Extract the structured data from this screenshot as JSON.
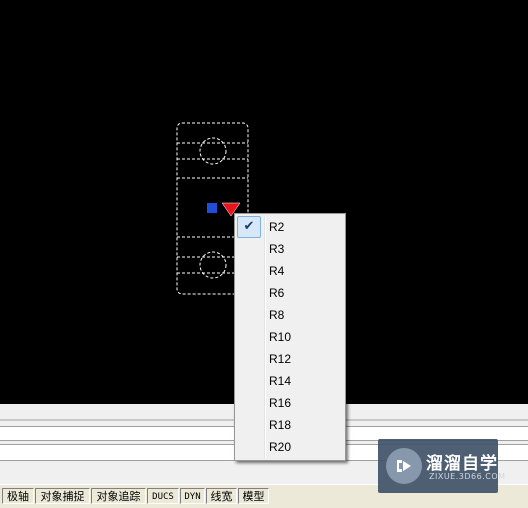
{
  "drawing": {
    "grip_colors": {
      "base_grip": "#1f4fd8",
      "lookup_grip": "#e8141e"
    }
  },
  "context_menu": {
    "items": [
      {
        "label": "R2",
        "checked": true
      },
      {
        "label": "R3",
        "checked": false
      },
      {
        "label": "R4",
        "checked": false
      },
      {
        "label": "R6",
        "checked": false
      },
      {
        "label": "R8",
        "checked": false
      },
      {
        "label": "R10",
        "checked": false
      },
      {
        "label": "R12",
        "checked": false
      },
      {
        "label": "R14",
        "checked": false
      },
      {
        "label": "R16",
        "checked": false
      },
      {
        "label": "R18",
        "checked": false
      },
      {
        "label": "R20",
        "checked": false
      }
    ],
    "check_icon": "checkmark-icon"
  },
  "status_bar": {
    "buttons": [
      "极轴",
      "对象捕捉",
      "对象追踪",
      "DUCS",
      "DYN",
      "线宽",
      "模型"
    ]
  },
  "watermark": {
    "title": "溜溜自学",
    "subtitle": "ZIXUE.3D66.COM",
    "icon": "play-icon"
  }
}
